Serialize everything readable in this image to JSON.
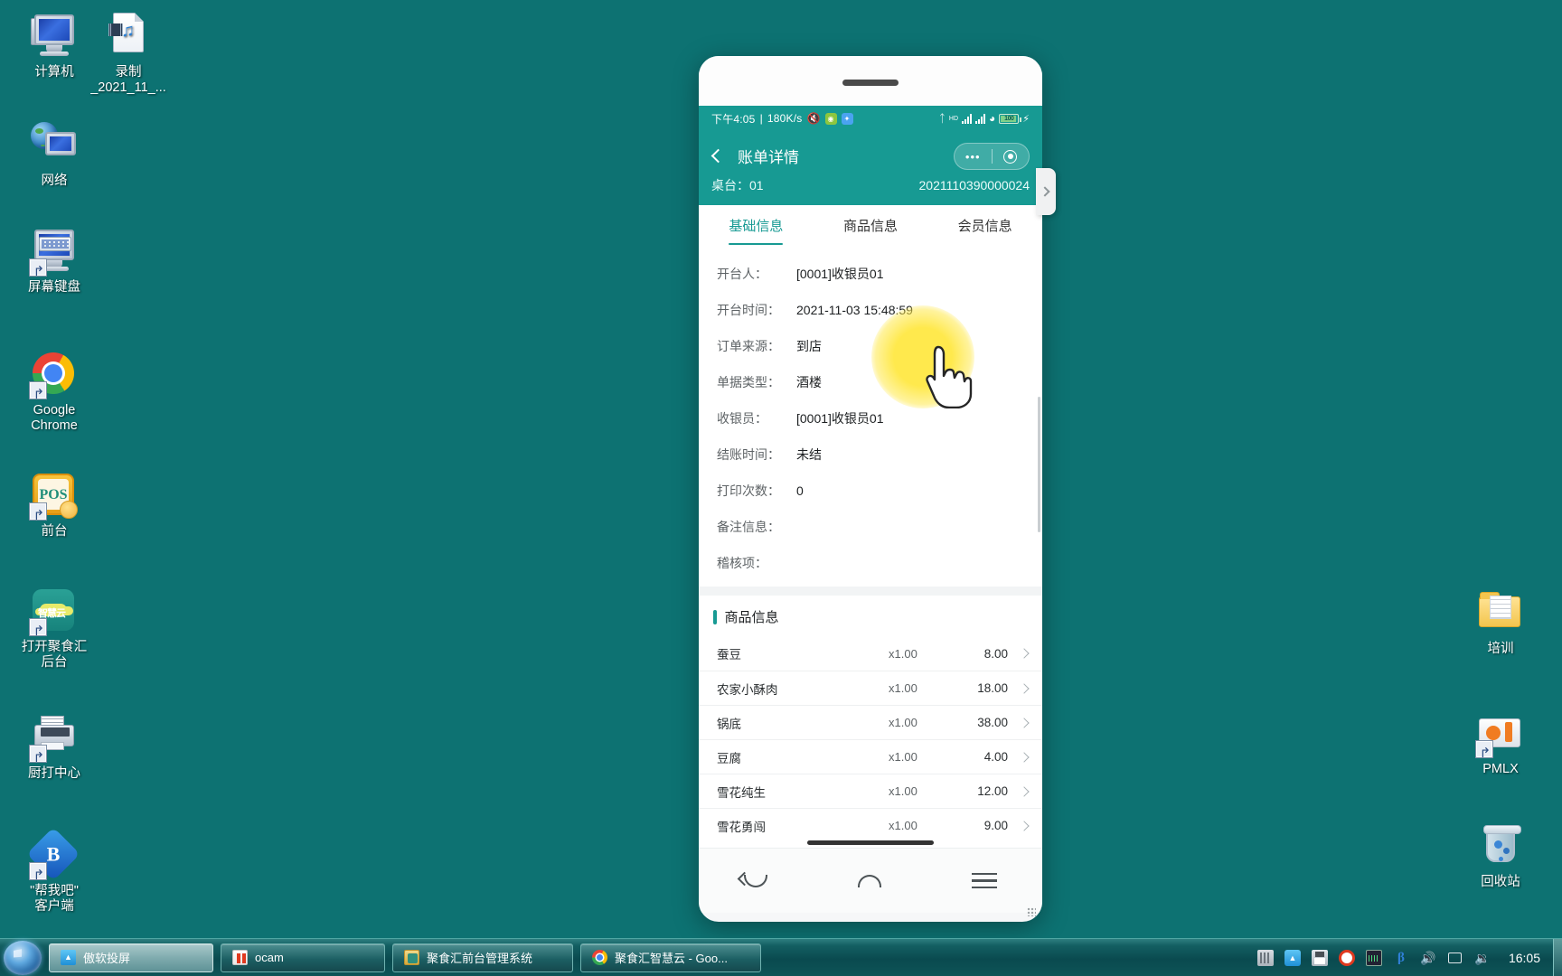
{
  "desktop": {
    "left_icons": [
      {
        "label": "计算机",
        "icon": "computer-icon"
      },
      {
        "label": "录制\n_2021_11_...",
        "icon": "video-file-icon"
      },
      {
        "label": "网络",
        "icon": "network-icon"
      },
      {
        "label": "屏幕键盘",
        "icon": "on-screen-keyboard-icon"
      },
      {
        "label": "Google\nChrome",
        "icon": "chrome-icon"
      },
      {
        "label": "前台",
        "icon": "pos-icon"
      },
      {
        "label": "打开聚食汇\n后台",
        "icon": "cloud-app-icon"
      },
      {
        "label": "厨打中心",
        "icon": "printer-icon"
      },
      {
        "label": "\"帮我吧\"\n客户端",
        "icon": "help-client-icon"
      }
    ],
    "right_icons": [
      {
        "label": "培训",
        "icon": "folder-icon"
      },
      {
        "label": "PMLX",
        "icon": "pmlx-folder-icon"
      },
      {
        "label": "回收站",
        "icon": "recycle-bin-icon"
      }
    ]
  },
  "phone": {
    "statusbar": {
      "time": "下午4:05",
      "netspeed": "180K/s",
      "mute_icon": "mute-icon",
      "badges": [
        "green-app-badge",
        "blue-app-badge"
      ],
      "bluetooth_icon": "bluetooth-icon",
      "hd_label": "HD",
      "signal_icon": "signal-bars-icon",
      "wifi_icon": "wifi-icon",
      "battery_level": "100",
      "charging_icon": "charging-bolt-icon"
    },
    "appbar": {
      "back_icon": "back-chevron-icon",
      "title": "账单详情",
      "menu_dots": "•••",
      "target_icon": "target-circle-icon",
      "table_label": "桌台：01",
      "order_no": "2021110390000024"
    },
    "tabs": [
      {
        "label": "基础信息",
        "active": true
      },
      {
        "label": "商品信息",
        "active": false
      },
      {
        "label": "会员信息",
        "active": false
      }
    ],
    "basic_info": [
      {
        "label": "开台人：",
        "value": "[0001]收银员01"
      },
      {
        "label": "开台时间：",
        "value": "2021-11-03 15:48:59"
      },
      {
        "label": "订单来源：",
        "value": "到店"
      },
      {
        "label": "单据类型：",
        "value": "酒楼"
      },
      {
        "label": "收银员：",
        "value": "[0001]收银员01"
      },
      {
        "label": "结账时间：",
        "value": "未结"
      },
      {
        "label": "打印次数：",
        "value": "0"
      },
      {
        "label": "备注信息：",
        "value": ""
      },
      {
        "label": "稽核项：",
        "value": ""
      }
    ],
    "goods_section_title": "商品信息",
    "goods": [
      {
        "name": "蚕豆",
        "qty": "x1.00",
        "amount": "8.00"
      },
      {
        "name": "农家小酥肉",
        "qty": "x1.00",
        "amount": "18.00"
      },
      {
        "name": "锅底",
        "qty": "x1.00",
        "amount": "38.00"
      },
      {
        "name": "豆腐",
        "qty": "x1.00",
        "amount": "4.00"
      },
      {
        "name": "雪花纯生",
        "qty": "x1.00",
        "amount": "12.00"
      },
      {
        "name": "雪花勇闯",
        "qty": "x1.00",
        "amount": "9.00"
      }
    ],
    "navbar": {
      "back": "nav-back-icon",
      "home": "nav-home-icon",
      "recents": "nav-menu-icon"
    },
    "peek_arrow": "peek-chevron-right-icon"
  },
  "taskbar": {
    "start_label": "start-orb",
    "items": [
      {
        "label": "傲软投屏",
        "icon": "apowermirror-icon",
        "active": true
      },
      {
        "label": "ocam",
        "icon": "ocam-icon",
        "active": false
      },
      {
        "label": "聚食汇前台管理系统",
        "icon": "jushihui-pos-icon",
        "active": false
      },
      {
        "label": "聚食汇智慧云 - Goo...",
        "icon": "chrome-icon",
        "active": false
      }
    ],
    "tray_icons": [
      "keyboard-icon",
      "apowermirror-icon",
      "save-icon",
      "record-icon",
      "monitor-icon",
      "baidu-icon",
      "speaker-icon",
      "network-icon",
      "volume-icon"
    ],
    "clock": "16:05",
    "show_desktop": "show-desktop-button"
  },
  "colors": {
    "desktop_bg": "#0d7272",
    "app_teal": "#179a93",
    "highlight_yellow": "#ffe94d"
  }
}
